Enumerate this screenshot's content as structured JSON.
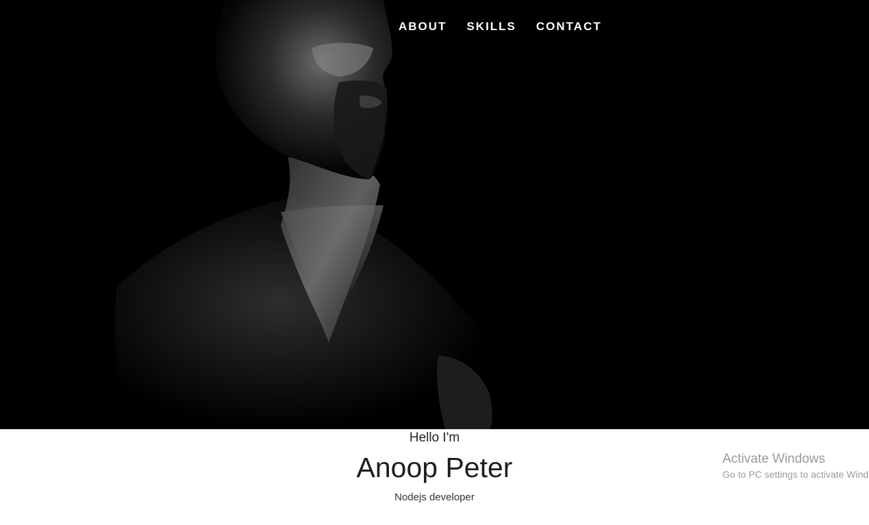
{
  "nav": {
    "items": [
      {
        "label": "ABOUT"
      },
      {
        "label": "SKILLS"
      },
      {
        "label": "CONTACT"
      }
    ]
  },
  "hero": {
    "background_color": "#000000",
    "image_alt": "profile portrait of a bearded man in dark lighting"
  },
  "intro": {
    "greeting": "Hello I'm",
    "name": "Anoop Peter",
    "role": "Nodejs developer"
  },
  "watermark": {
    "title": "Activate Windows",
    "subtitle": "Go to PC settings to activate Windows."
  }
}
